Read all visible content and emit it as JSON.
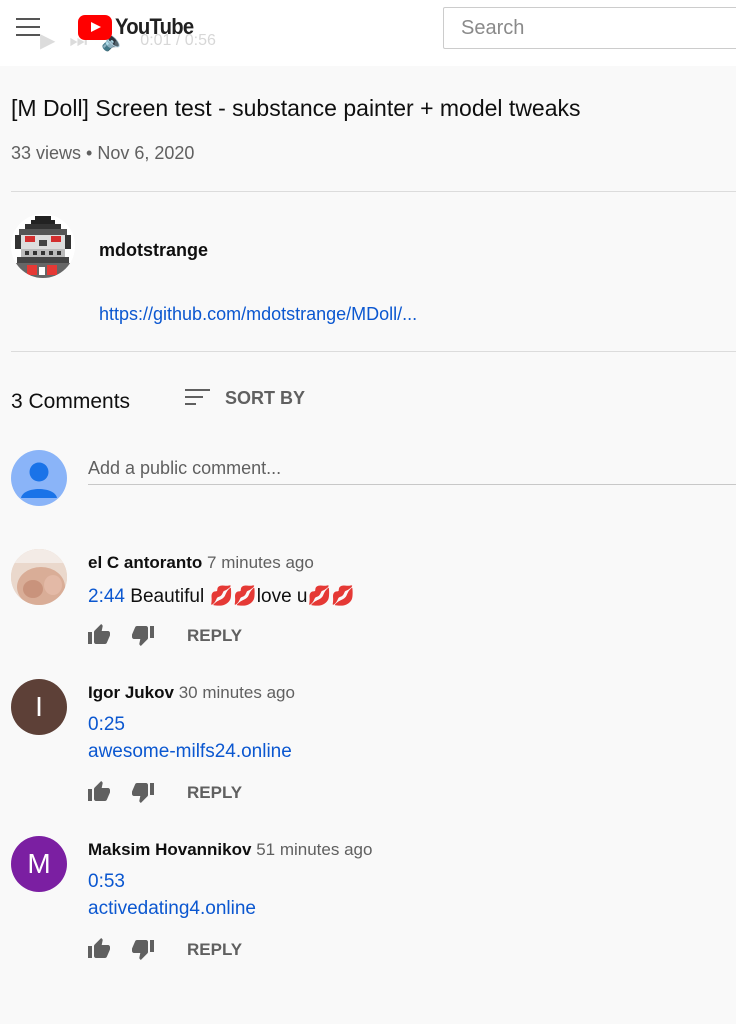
{
  "header": {
    "logo_text": "YouTube",
    "search_placeholder": "Search",
    "player_time": "0:01 / 0:56"
  },
  "video": {
    "title": "[M Doll] Screen test - substance painter + model tweaks",
    "meta": "33 views • Nov 6, 2020",
    "channel_name": "mdotstrange",
    "description_link": "https://github.com/mdotstrange/MDoll/..."
  },
  "comments_section": {
    "count_label": "3 Comments",
    "sort_label": "SORT BY",
    "add_placeholder": "Add a public comment..."
  },
  "comments": [
    {
      "author": "el C antoranto",
      "time": "7 minutes ago",
      "timestamp_link": "2:44",
      "text": "Beautiful 💋💋love u💋💋",
      "reply_label": "REPLY"
    },
    {
      "author": "Igor Jukov",
      "time": "30 minutes ago",
      "avatar_letter": "I",
      "avatar_color": "#5d4037",
      "timestamp_link": "0:25",
      "link": "awesome-milfs24.online",
      "reply_label": "REPLY"
    },
    {
      "author": "Maksim Hovannikov",
      "time": "51 minutes ago",
      "avatar_letter": "M",
      "avatar_color": "#7b1fa2",
      "timestamp_link": "0:53",
      "link": "activedating4.online",
      "reply_label": "REPLY"
    }
  ],
  "colors": {
    "link": "#0b57d0",
    "brand_red": "#ff0000",
    "secondary_text": "#606060"
  }
}
